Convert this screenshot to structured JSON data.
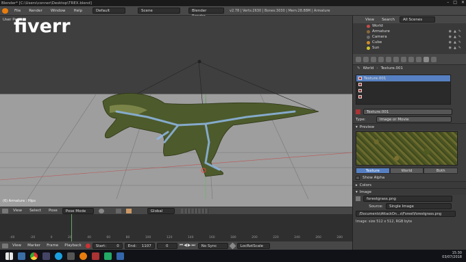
{
  "window": {
    "title": "Blender* [C:\\Users\\conner\\Desktop\\TREX.blend]",
    "controls": [
      "–",
      "□",
      "✕"
    ]
  },
  "menubar": {
    "items": [
      "File",
      "Render",
      "Window",
      "Help"
    ],
    "layout": "Default",
    "scene": "Scene",
    "engine": "Blender Render",
    "stats": "v2.78 | Verts:2630 | Bones:3030 | Mem:28.88M | Armature"
  },
  "watermark": "fiverr",
  "viewport": {
    "label": "User Persp",
    "object_label": "(6) Armature : Hips",
    "header": {
      "menus": [
        "View",
        "Select",
        "Pose"
      ],
      "mode": "Pose Mode",
      "orientation": "Global"
    }
  },
  "timeline": {
    "ticks": [
      "-40",
      "-20",
      "0",
      "20",
      "40",
      "60",
      "80",
      "100",
      "120",
      "140",
      "160",
      "180",
      "200",
      "220",
      "240",
      "260",
      "280"
    ],
    "menus": [
      "View",
      "Marker",
      "Frame",
      "Playback"
    ],
    "start_label": "Start:",
    "start_value": "0",
    "end_label": "End:",
    "end_value": "1107",
    "current_frame": "0",
    "sync": "No Sync",
    "keying": "LocRotScale"
  },
  "outliner": {
    "menus": [
      "View",
      "Search"
    ],
    "filter": "All Scenes",
    "items": [
      {
        "label": "World",
        "color": "#c24b4b"
      },
      {
        "label": "Armature",
        "color": "#8a6a3a"
      },
      {
        "label": "Camera",
        "color": "#6a6a6a"
      },
      {
        "label": "Cube",
        "color": "#d28b2e"
      },
      {
        "label": "Sun",
        "color": "#d2c32e"
      }
    ]
  },
  "properties": {
    "breadcrumb": [
      "World",
      "Texture.001"
    ],
    "slots": [
      "Texture.001",
      "",
      "",
      "",
      ""
    ],
    "texture_name": "Texture.001",
    "type_label": "Type:",
    "type_value": "Image or Movie",
    "preview_label": "Preview",
    "tabs": [
      "Texture",
      "World",
      "Both"
    ],
    "show_alpha": "Show Alpha",
    "colors_label": "Colors",
    "image_label": "Image",
    "image_name": "forestgrass.png",
    "source_label": "Source:",
    "source_value": "Single Image",
    "filepath": "/Documents\\AttackOn...s\\Forest\\forestgrass.png",
    "image_info": "Image: size 512 x 512, RGB byte"
  },
  "taskbar": {
    "time": "15:30",
    "date": "03/07/2018"
  },
  "colors": {
    "accent": "#5680c2",
    "panel": "#3d3d3d",
    "header": "#474747"
  }
}
